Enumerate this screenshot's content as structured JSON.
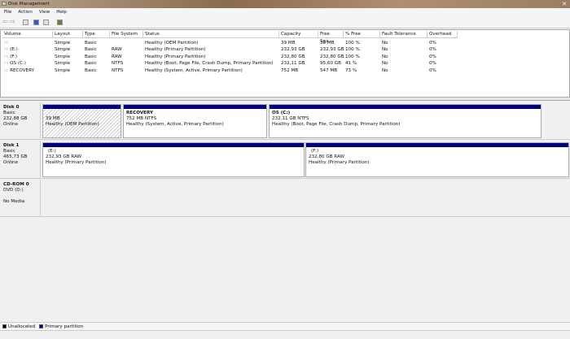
{
  "window": {
    "title": "Disk Management"
  },
  "menu": [
    "File",
    "Action",
    "View",
    "Help"
  ],
  "toolbar": [
    "back-icon",
    "forward-icon",
    "properties-icon",
    "help-icon",
    "console-icon",
    "settings-icon"
  ],
  "list": {
    "columns": [
      "Volume",
      "Layout",
      "Type",
      "File System",
      "Status",
      "Capacity",
      "Free Spa...",
      "% Free",
      "Fault Tolerance",
      "Overhead"
    ],
    "rows": [
      [
        "",
        "Simple",
        "Basic",
        "",
        "Healthy (OEM Partition)",
        "39 MB",
        "39 MB",
        "100 %",
        "No",
        "0%"
      ],
      [
        "(E:)",
        "Simple",
        "Basic",
        "RAW",
        "Healthy (Primary Partition)",
        "232,93 GB",
        "232,93 GB",
        "100 %",
        "No",
        "0%"
      ],
      [
        "(F:)",
        "Simple",
        "Basic",
        "RAW",
        "Healthy (Primary Partition)",
        "232,80 GB",
        "232,80 GB",
        "100 %",
        "No",
        "0%"
      ],
      [
        "OS (C:)",
        "Simple",
        "Basic",
        "NTFS",
        "Healthy (Boot, Page File, Crash Dump, Primary Partition)",
        "232,11 GB",
        "95,60 GB",
        "41 %",
        "No",
        "0%"
      ],
      [
        "RECOVERY",
        "Simple",
        "Basic",
        "NTFS",
        "Healthy (System, Active, Primary Partition)",
        "752 MB",
        "547 MB",
        "73 %",
        "No",
        "0%"
      ]
    ]
  },
  "disks": [
    {
      "name": "Disk 0",
      "type": "Basic",
      "size": "232,88 GB",
      "state": "Online",
      "partitions": [
        {
          "name": "",
          "size": "39 MB",
          "status": "Healthy (OEM Partition)"
        },
        {
          "name": "RECOVERY",
          "size": "752 MB NTFS",
          "status": "Healthy (System, Active, Primary Partition)"
        },
        {
          "name": "OS  (C:)",
          "size": "232,11 GB NTFS",
          "status": "Healthy (Boot, Page File, Crash Dump, Primary Partition)"
        }
      ]
    },
    {
      "name": "Disk 1",
      "type": "Basic",
      "size": "465,73 GB",
      "state": "Online",
      "partitions": [
        {
          "name": "(E:)",
          "size": "232,93 GB RAW",
          "status": "Healthy (Primary Partition)"
        },
        {
          "name": "(F:)",
          "size": "232,80 GB RAW",
          "status": "Healthy (Primary Partition)"
        }
      ]
    },
    {
      "name": "CD-ROM 0",
      "type": "DVD (D:)",
      "state": "No Media"
    }
  ],
  "legend": [
    {
      "label": "Unallocated",
      "color": "#000000"
    },
    {
      "label": "Primary partition",
      "color": "#000080"
    }
  ]
}
